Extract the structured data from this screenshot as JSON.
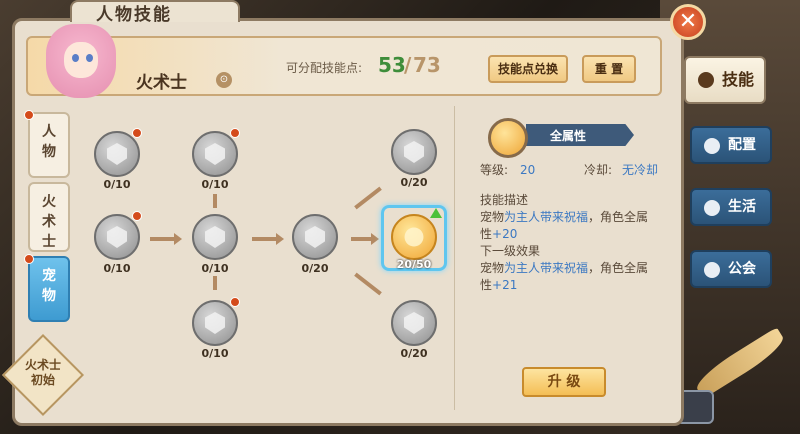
{
  "window": {
    "title": "人物技能",
    "close": "✕"
  },
  "header": {
    "class_name": "火术士",
    "class_icon": "⊙",
    "points_label": "可分配技能点:",
    "points_current": "53",
    "points_sep": "/",
    "points_total": "73",
    "exchange_label": "技能点兑换",
    "reset_label": "重 置"
  },
  "left_tabs": [
    {
      "label": "人物"
    },
    {
      "label": "火术士"
    },
    {
      "label": "宠物"
    }
  ],
  "badge": {
    "line1": "火术士",
    "line2": "初始"
  },
  "tree": {
    "levels": [
      "0/10",
      "0/10",
      "0/10",
      "0/10",
      "0/10",
      "0/20",
      "0/20",
      "20/50",
      "0/20"
    ]
  },
  "detail": {
    "name": "全属性",
    "level_label": "等级:",
    "level_value": "20",
    "cooldown_label": "冷却:",
    "cooldown_value": "无冷却",
    "desc_title": "技能描述",
    "desc_a": "宠物",
    "desc_b": "为主人带来祝福",
    "desc_c": "，角色全属性",
    "desc_d": "+20",
    "next_title": "下一级效果",
    "next_a": "宠物",
    "next_b": "为主人带来祝福",
    "next_c": "，角色全属性",
    "next_d": "+21",
    "upgrade_label": "升 级"
  },
  "right_tabs": [
    {
      "label": "技能"
    },
    {
      "label": "配置"
    },
    {
      "label": "生活"
    },
    {
      "label": "公会"
    }
  ]
}
